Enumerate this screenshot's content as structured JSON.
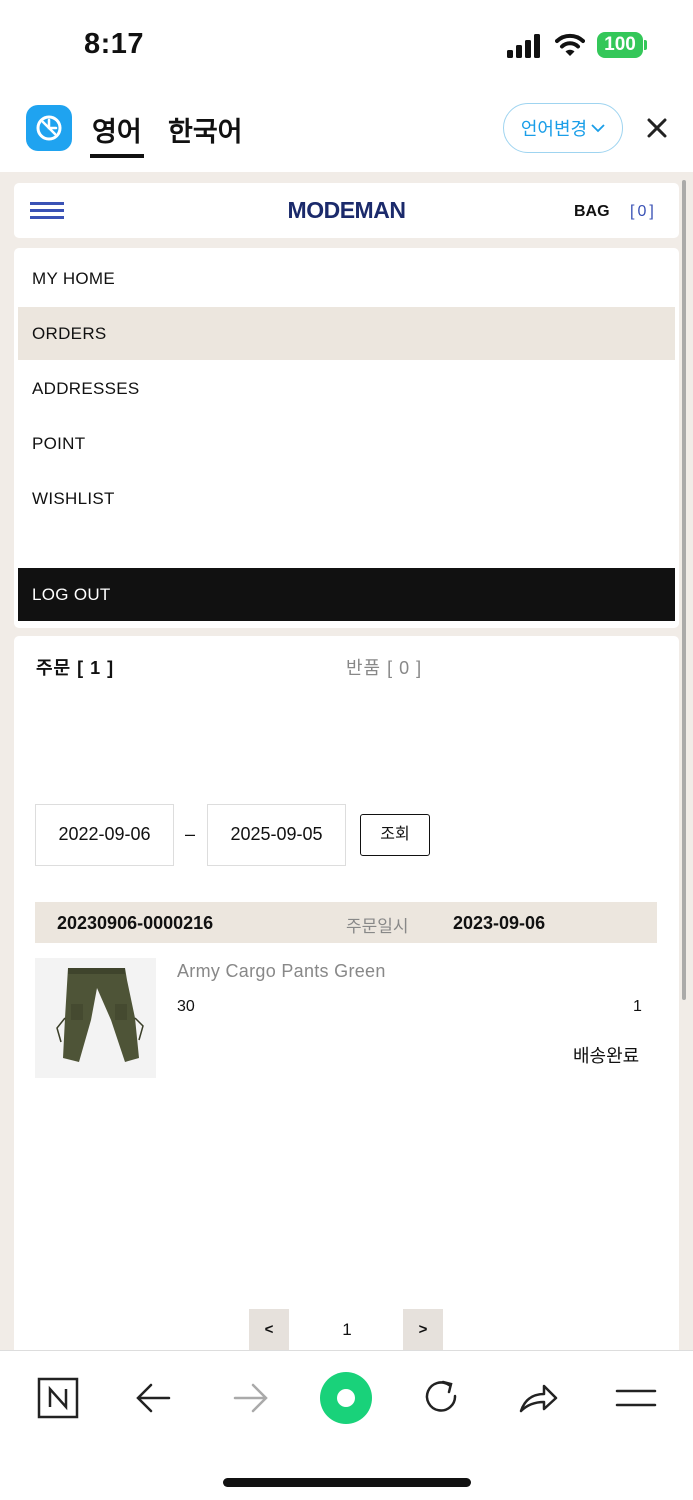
{
  "status_bar": {
    "time": "8:17",
    "battery": "100",
    "battery_color": "#34c759"
  },
  "translator": {
    "tab_source": "영어",
    "tab_target": "한국어",
    "change_language": "언어변경",
    "accent": "#1a9ee8"
  },
  "site": {
    "logo": "MODEMAN",
    "bag_label": "BAG",
    "bag_count": "[0]",
    "brand_color": "#1b2a6b"
  },
  "menu": {
    "items": [
      {
        "label": "MY HOME"
      },
      {
        "label": "ORDERS"
      },
      {
        "label": "ADDRESSES"
      },
      {
        "label": "POINT"
      },
      {
        "label": "WISHLIST"
      }
    ],
    "active_index": 1,
    "logout": "LOG OUT"
  },
  "orders": {
    "tab_orders": "주문 [ 1 ]",
    "tab_returns": "반품 [ 0 ]",
    "date_from": "2022-09-06",
    "date_separator": "–",
    "date_to": "2025-09-05",
    "search_label": "조회",
    "order": {
      "number": "20230906-0000216",
      "date_label": "주문일시",
      "date": "2023-09-06",
      "product_name": "Army Cargo Pants Green",
      "option": "30",
      "quantity": "1",
      "status": "배송완료"
    },
    "pager": {
      "prev": "<",
      "current": "1",
      "next": ">"
    }
  },
  "toolbar": {
    "icons": [
      "naver-n-icon",
      "back-arrow-icon",
      "forward-arrow-icon",
      "green-dot-icon",
      "reload-icon",
      "share-icon",
      "menu-icon"
    ]
  }
}
